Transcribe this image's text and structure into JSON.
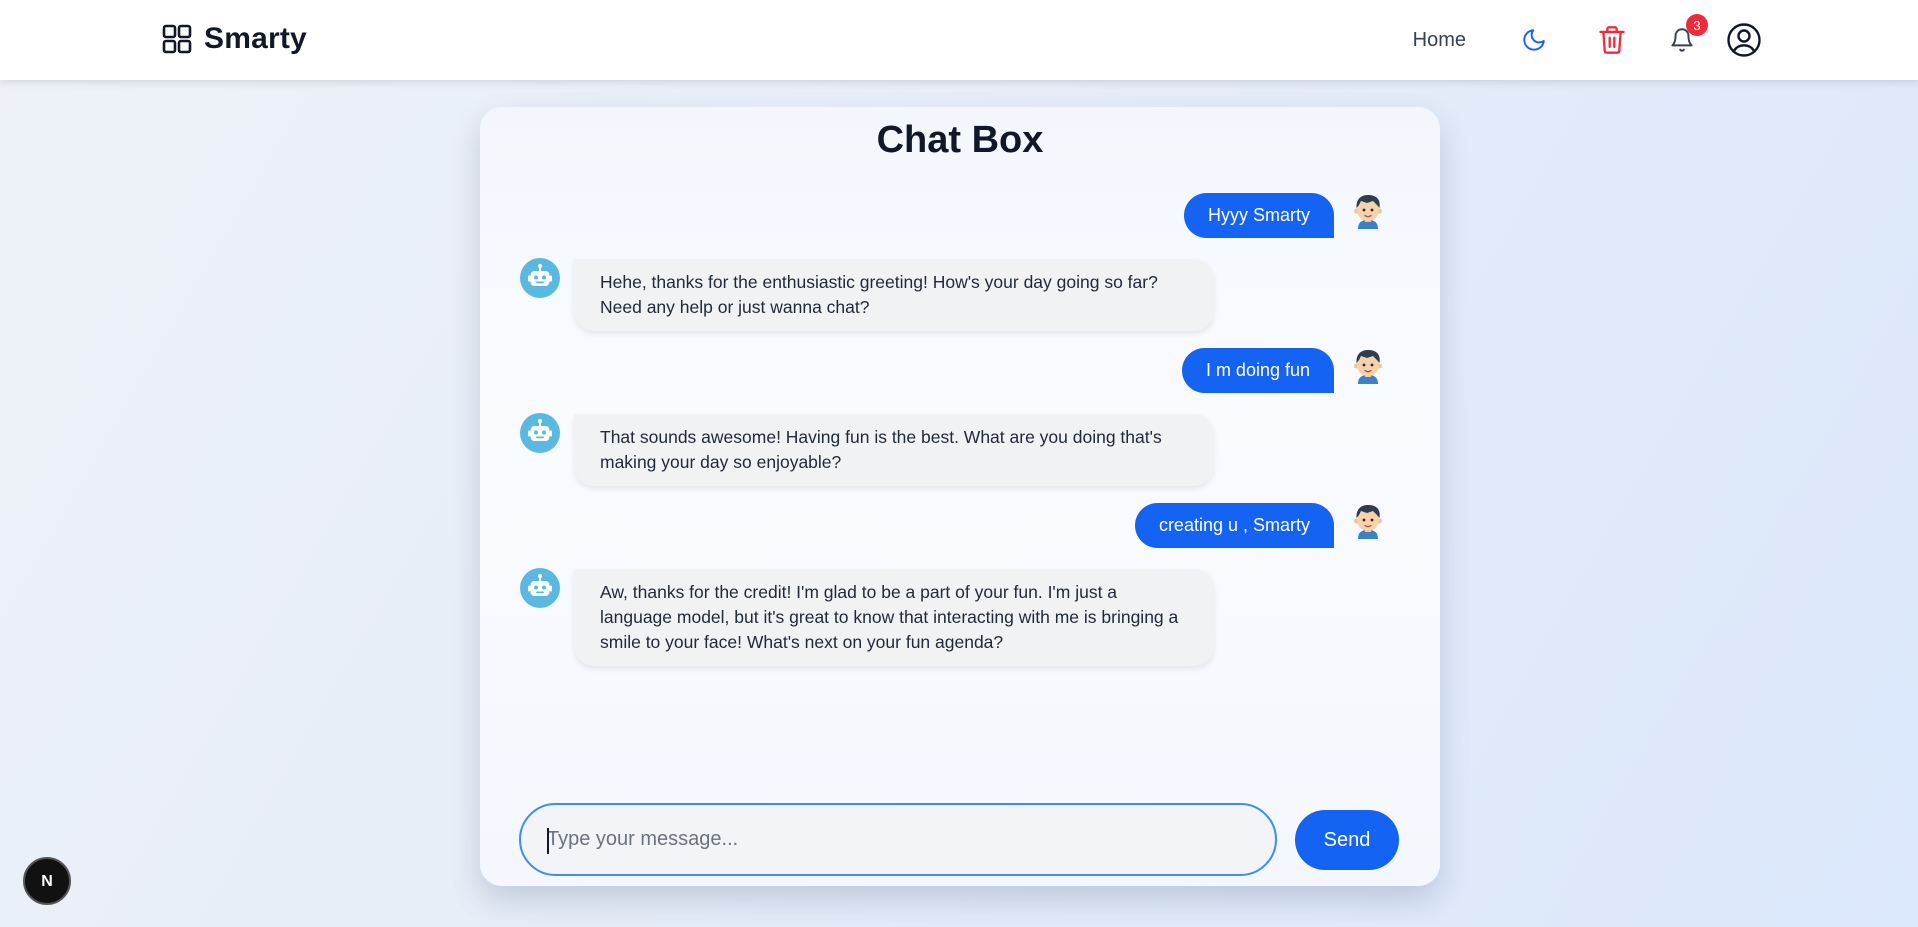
{
  "brand": {
    "name": "Smarty",
    "icon": "grid-icon"
  },
  "nav": {
    "home_label": "Home",
    "icons": [
      "moon-icon",
      "trash-icon",
      "bell-icon",
      "user-circle-icon"
    ],
    "notification_count": "3"
  },
  "chat": {
    "title": "Chat Box",
    "messages": [
      {
        "role": "user",
        "text": "Hyyy Smarty"
      },
      {
        "role": "bot",
        "text": "Hehe, thanks for the enthusiastic greeting! How's your day going so far? Need any help or just wanna chat?"
      },
      {
        "role": "user",
        "text": "I m doing fun"
      },
      {
        "role": "bot",
        "text": "That sounds awesome! Having fun is the best. What are you doing that's making your day so enjoyable?"
      },
      {
        "role": "user",
        "text": "creating u , Smarty"
      },
      {
        "role": "bot",
        "text": "Aw, thanks for the credit! I'm glad to be a part of your fun. I'm just a language model, but it's great to know that interacting with me is bringing a smile to your face! What's next on your fun agenda?"
      }
    ],
    "input_placeholder": "Type your message...",
    "input_value": "",
    "send_label": "Send"
  },
  "dev_badge": {
    "letter": "N"
  },
  "colors": {
    "accent": "#1463f3",
    "danger": "#ef2b3a",
    "bot_bubble": "#f1f2f4",
    "bot_avatar": "#5bb8e0",
    "input_border": "#3b8ff0"
  }
}
